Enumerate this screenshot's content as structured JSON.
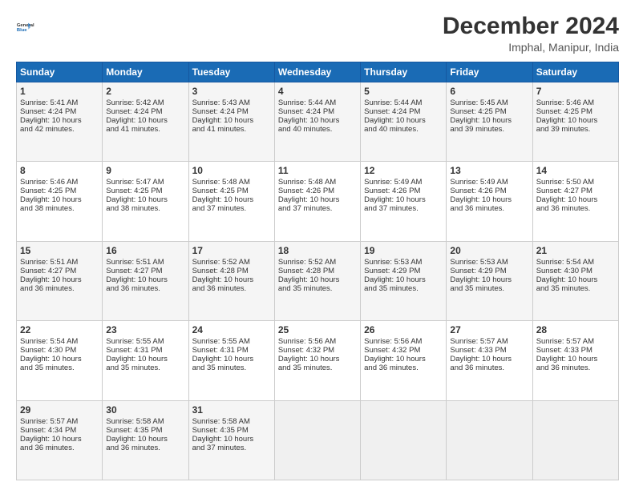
{
  "logo": {
    "line1": "General",
    "line2": "Blue"
  },
  "title": "December 2024",
  "subtitle": "Imphal, Manipur, India",
  "weekdays": [
    "Sunday",
    "Monday",
    "Tuesday",
    "Wednesday",
    "Thursday",
    "Friday",
    "Saturday"
  ],
  "weeks": [
    [
      {
        "day": 1,
        "sunrise": "5:41 AM",
        "sunset": "4:24 PM",
        "daylight": "10 hours and 42 minutes."
      },
      {
        "day": 2,
        "sunrise": "5:42 AM",
        "sunset": "4:24 PM",
        "daylight": "10 hours and 41 minutes."
      },
      {
        "day": 3,
        "sunrise": "5:43 AM",
        "sunset": "4:24 PM",
        "daylight": "10 hours and 41 minutes."
      },
      {
        "day": 4,
        "sunrise": "5:44 AM",
        "sunset": "4:24 PM",
        "daylight": "10 hours and 40 minutes."
      },
      {
        "day": 5,
        "sunrise": "5:44 AM",
        "sunset": "4:24 PM",
        "daylight": "10 hours and 40 minutes."
      },
      {
        "day": 6,
        "sunrise": "5:45 AM",
        "sunset": "4:25 PM",
        "daylight": "10 hours and 39 minutes."
      },
      {
        "day": 7,
        "sunrise": "5:46 AM",
        "sunset": "4:25 PM",
        "daylight": "10 hours and 39 minutes."
      }
    ],
    [
      {
        "day": 8,
        "sunrise": "5:46 AM",
        "sunset": "4:25 PM",
        "daylight": "10 hours and 38 minutes."
      },
      {
        "day": 9,
        "sunrise": "5:47 AM",
        "sunset": "4:25 PM",
        "daylight": "10 hours and 38 minutes."
      },
      {
        "day": 10,
        "sunrise": "5:48 AM",
        "sunset": "4:25 PM",
        "daylight": "10 hours and 37 minutes."
      },
      {
        "day": 11,
        "sunrise": "5:48 AM",
        "sunset": "4:26 PM",
        "daylight": "10 hours and 37 minutes."
      },
      {
        "day": 12,
        "sunrise": "5:49 AM",
        "sunset": "4:26 PM",
        "daylight": "10 hours and 37 minutes."
      },
      {
        "day": 13,
        "sunrise": "5:49 AM",
        "sunset": "4:26 PM",
        "daylight": "10 hours and 36 minutes."
      },
      {
        "day": 14,
        "sunrise": "5:50 AM",
        "sunset": "4:27 PM",
        "daylight": "10 hours and 36 minutes."
      }
    ],
    [
      {
        "day": 15,
        "sunrise": "5:51 AM",
        "sunset": "4:27 PM",
        "daylight": "10 hours and 36 minutes."
      },
      {
        "day": 16,
        "sunrise": "5:51 AM",
        "sunset": "4:27 PM",
        "daylight": "10 hours and 36 minutes."
      },
      {
        "day": 17,
        "sunrise": "5:52 AM",
        "sunset": "4:28 PM",
        "daylight": "10 hours and 36 minutes."
      },
      {
        "day": 18,
        "sunrise": "5:52 AM",
        "sunset": "4:28 PM",
        "daylight": "10 hours and 35 minutes."
      },
      {
        "day": 19,
        "sunrise": "5:53 AM",
        "sunset": "4:29 PM",
        "daylight": "10 hours and 35 minutes."
      },
      {
        "day": 20,
        "sunrise": "5:53 AM",
        "sunset": "4:29 PM",
        "daylight": "10 hours and 35 minutes."
      },
      {
        "day": 21,
        "sunrise": "5:54 AM",
        "sunset": "4:30 PM",
        "daylight": "10 hours and 35 minutes."
      }
    ],
    [
      {
        "day": 22,
        "sunrise": "5:54 AM",
        "sunset": "4:30 PM",
        "daylight": "10 hours and 35 minutes."
      },
      {
        "day": 23,
        "sunrise": "5:55 AM",
        "sunset": "4:31 PM",
        "daylight": "10 hours and 35 minutes."
      },
      {
        "day": 24,
        "sunrise": "5:55 AM",
        "sunset": "4:31 PM",
        "daylight": "10 hours and 35 minutes."
      },
      {
        "day": 25,
        "sunrise": "5:56 AM",
        "sunset": "4:32 PM",
        "daylight": "10 hours and 35 minutes."
      },
      {
        "day": 26,
        "sunrise": "5:56 AM",
        "sunset": "4:32 PM",
        "daylight": "10 hours and 36 minutes."
      },
      {
        "day": 27,
        "sunrise": "5:57 AM",
        "sunset": "4:33 PM",
        "daylight": "10 hours and 36 minutes."
      },
      {
        "day": 28,
        "sunrise": "5:57 AM",
        "sunset": "4:33 PM",
        "daylight": "10 hours and 36 minutes."
      }
    ],
    [
      {
        "day": 29,
        "sunrise": "5:57 AM",
        "sunset": "4:34 PM",
        "daylight": "10 hours and 36 minutes."
      },
      {
        "day": 30,
        "sunrise": "5:58 AM",
        "sunset": "4:35 PM",
        "daylight": "10 hours and 36 minutes."
      },
      {
        "day": 31,
        "sunrise": "5:58 AM",
        "sunset": "4:35 PM",
        "daylight": "10 hours and 37 minutes."
      },
      null,
      null,
      null,
      null
    ]
  ],
  "labels": {
    "sunrise": "Sunrise:",
    "sunset": "Sunset:",
    "daylight": "Daylight:"
  }
}
